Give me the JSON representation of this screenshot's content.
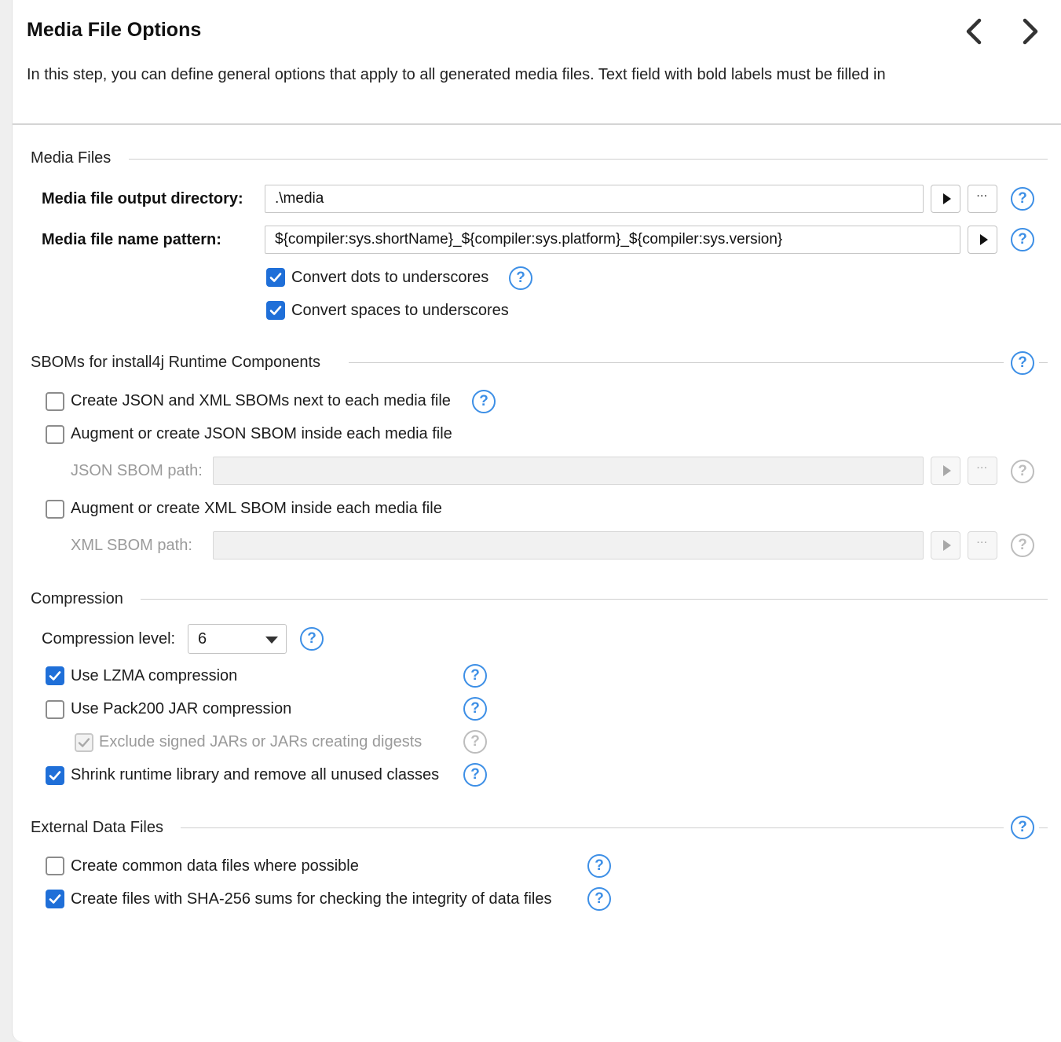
{
  "header": {
    "title": "Media File Options",
    "description": "In this step, you can define general options that apply to all generated media files. Text field with bold labels must be filled in"
  },
  "media_files": {
    "section_title": "Media Files",
    "output_dir_label": "Media file output directory:",
    "output_dir_value": ".\\media",
    "name_pattern_label": "Media file name pattern:",
    "name_pattern_value": "${compiler:sys.shortName}_${compiler:sys.platform}_${compiler:sys.version}",
    "convert_dots_label": "Convert dots to underscores",
    "convert_dots_checked": true,
    "convert_spaces_label": "Convert spaces to underscores",
    "convert_spaces_checked": true
  },
  "sboms": {
    "section_title": "SBOMs for install4j Runtime Components",
    "create_json_xml_label": "Create JSON and XML SBOMs next to each media file",
    "create_json_xml_checked": false,
    "augment_json_label": "Augment or create JSON SBOM inside each media file",
    "augment_json_checked": false,
    "json_path_label": "JSON SBOM path:",
    "json_path_value": "",
    "augment_xml_label": "Augment or create XML SBOM inside each media file",
    "augment_xml_checked": false,
    "xml_path_label": "XML SBOM path:",
    "xml_path_value": ""
  },
  "compression": {
    "section_title": "Compression",
    "level_label": "Compression level:",
    "level_value": "6",
    "lzma_label": "Use LZMA compression",
    "lzma_checked": true,
    "pack200_label": "Use Pack200 JAR compression",
    "pack200_checked": false,
    "exclude_signed_label": "Exclude signed JARs or JARs creating digests",
    "exclude_signed_checked": true,
    "shrink_label": "Shrink runtime library and remove all unused classes",
    "shrink_checked": true
  },
  "external": {
    "section_title": "External Data Files",
    "common_label": "Create common data files where possible",
    "common_checked": false,
    "sha_label": "Create files with SHA-256 sums for checking the integrity of data files",
    "sha_checked": true
  },
  "icons": {
    "help": "?",
    "ellipsis": "···",
    "back": "chevron-left-icon",
    "next": "chevron-right-icon"
  },
  "colors": {
    "accent": "#1f6fd8",
    "help_blue": "#3d8fe6",
    "disabled": "#9a9a9a"
  }
}
